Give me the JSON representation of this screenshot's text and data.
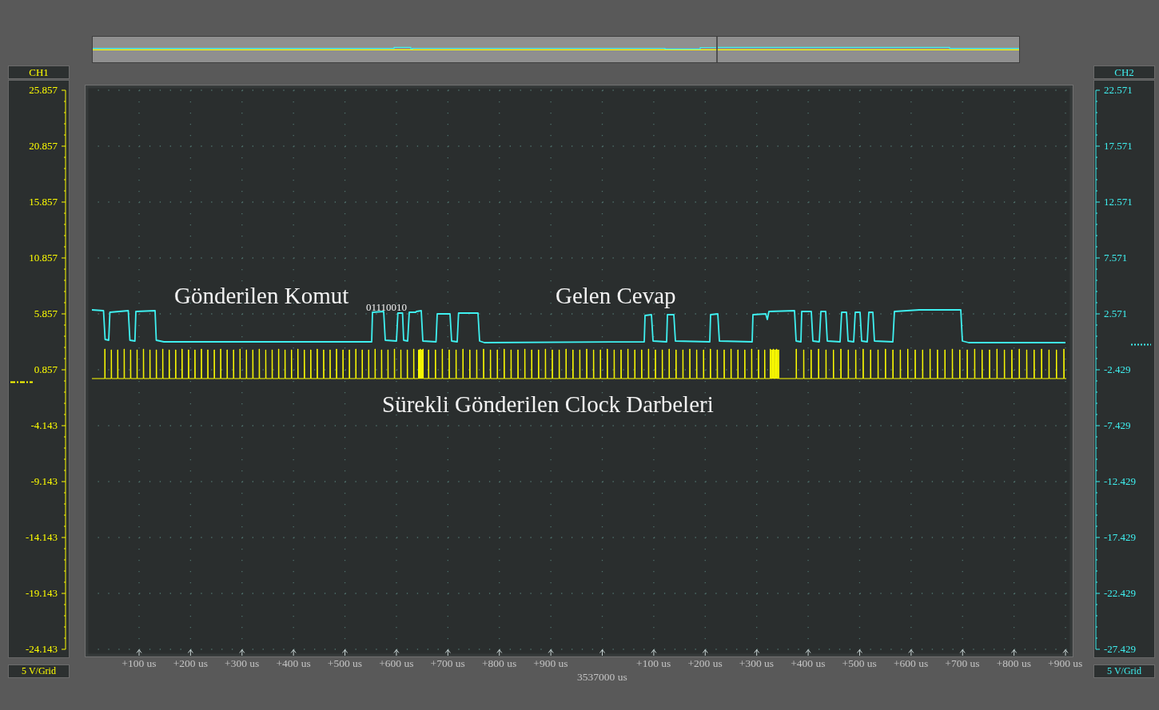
{
  "channels": [
    {
      "name": "CH1",
      "color": "#ffff00",
      "scale": "5 V/Grid",
      "ticks": [
        "25.857",
        "20.857",
        "15.857",
        "10.857",
        "5.857",
        "0.857",
        "-4.143",
        "-9.143",
        "-14.143",
        "-19.143",
        "-24.143"
      ]
    },
    {
      "name": "CH2",
      "color": "#3ff0f0",
      "scale": "5 V/Grid",
      "ticks": [
        "22.571",
        "17.571",
        "12.571",
        "7.571",
        "2.571",
        "-2.429",
        "-7.429",
        "-12.429",
        "-17.429",
        "-22.429",
        "-27.429"
      ]
    }
  ],
  "annotations": [
    {
      "kind": "caption",
      "text": "Gönderilen Komut"
    },
    {
      "kind": "bits",
      "text": "01110010"
    },
    {
      "kind": "caption",
      "text": "Gelen Cevap"
    },
    {
      "kind": "caption",
      "text": "Sürekli Gönderilen Clock Darbeleri"
    }
  ],
  "time_axis": {
    "ticks": [
      {
        "kind": "offset",
        "label": "+100 us"
      },
      {
        "kind": "offset",
        "label": "+200 us"
      },
      {
        "kind": "offset",
        "label": "+300 us"
      },
      {
        "kind": "offset",
        "label": "+400 us"
      },
      {
        "kind": "offset",
        "label": "+500 us"
      },
      {
        "kind": "offset",
        "label": "+600 us"
      },
      {
        "kind": "offset",
        "label": "+700 us"
      },
      {
        "kind": "offset",
        "label": "+800 us"
      },
      {
        "kind": "offset",
        "label": "+900 us"
      },
      {
        "kind": "origin",
        "label": "3537000 us"
      },
      {
        "kind": "offset",
        "label": "+100 us"
      },
      {
        "kind": "offset",
        "label": "+200 us"
      },
      {
        "kind": "offset",
        "label": "+300 us"
      },
      {
        "kind": "offset",
        "label": "+400 us"
      },
      {
        "kind": "offset",
        "label": "+500 us"
      },
      {
        "kind": "offset",
        "label": "+600 us"
      },
      {
        "kind": "offset",
        "label": "+700 us"
      },
      {
        "kind": "offset",
        "label": "+800 us"
      },
      {
        "kind": "offset",
        "label": "+900 us"
      }
    ]
  }
}
